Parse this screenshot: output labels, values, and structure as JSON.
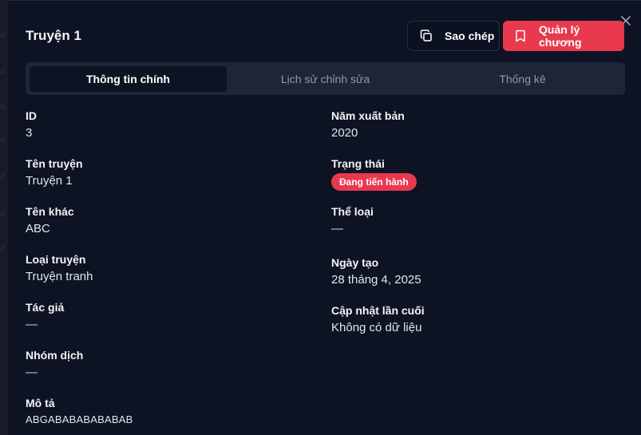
{
  "dialog": {
    "title": "Truyện 1",
    "close_icon": "close-icon",
    "actions": {
      "copy_label": "Sao chép",
      "copy_icon": "copy-icon",
      "manage_label": "Quản lý chương",
      "manage_icon": "bookmark-icon"
    },
    "tabs": [
      {
        "label": "Thông tin chính",
        "active": true
      },
      {
        "label": "Lịch sử chỉnh sửa",
        "active": false
      },
      {
        "label": "Thống kê",
        "active": false
      }
    ],
    "fields_left": [
      {
        "label": "ID",
        "value": "3"
      },
      {
        "label": "Tên truyện",
        "value": "Truyện 1"
      },
      {
        "label": "Tên khác",
        "value": "ABC"
      },
      {
        "label": "Loại truyện",
        "value": "Truyện tranh"
      },
      {
        "label": "Tác giả",
        "value": "—"
      },
      {
        "label": "Nhóm dịch",
        "value": "—"
      },
      {
        "label": "Mô tả",
        "value": "ABGABABABABABAB"
      }
    ],
    "fields_right": [
      {
        "label": "Năm xuất bản",
        "value": "2020"
      },
      {
        "label": "Trạng thái",
        "badge": "Đang tiến hành"
      },
      {
        "label": "Thể loại",
        "value": "—"
      },
      {
        "label": "Ngày tạo",
        "value": "28 tháng 4, 2025"
      },
      {
        "label": "Cập nhật lần cuối",
        "value": "Không có dữ liệu"
      }
    ]
  },
  "colors": {
    "background": "#0d1322",
    "accent": "#e8394f",
    "tab_bar": "#1c2638"
  }
}
